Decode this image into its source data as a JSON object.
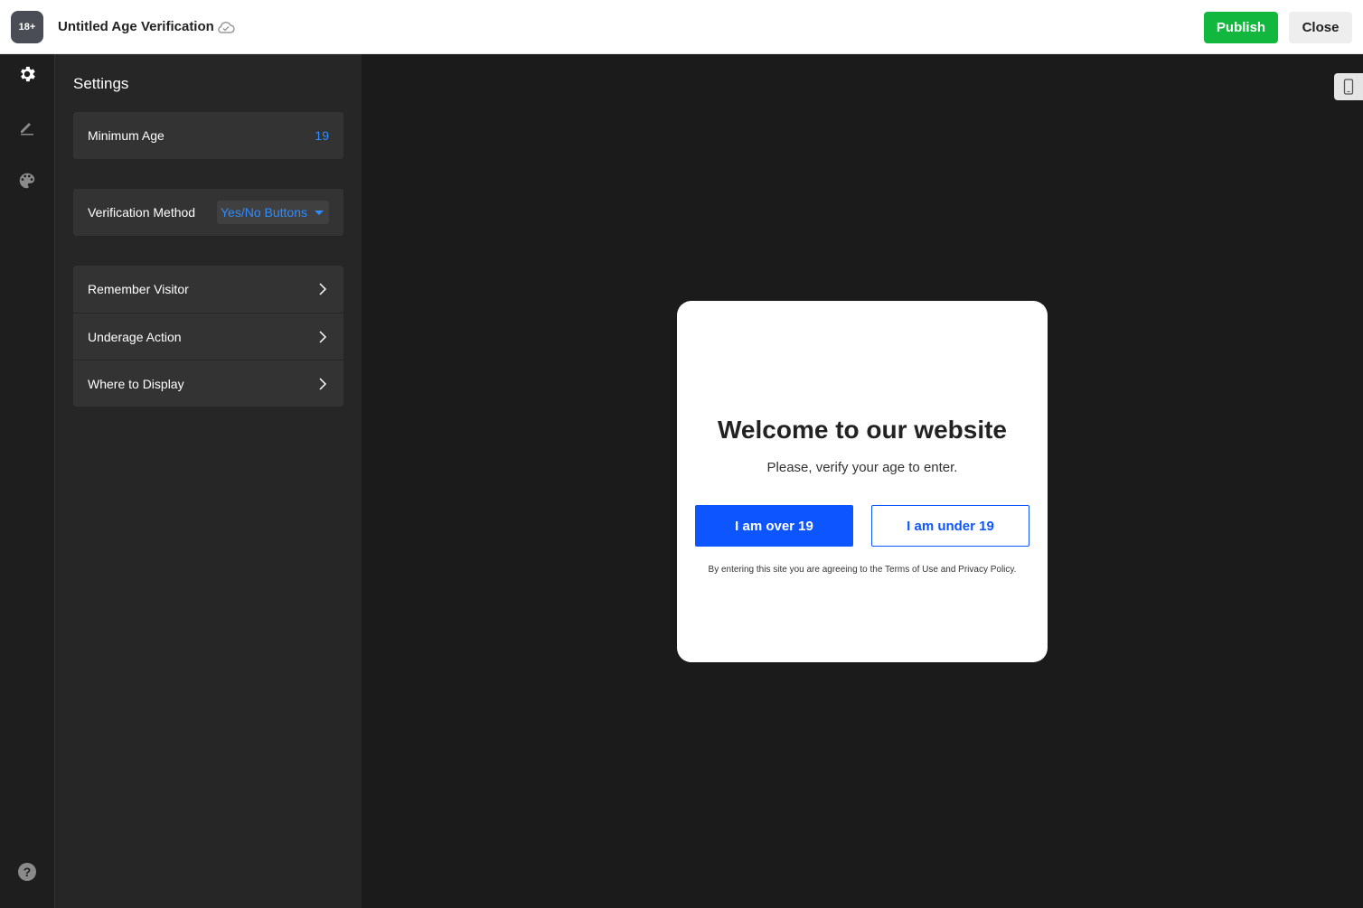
{
  "app": {
    "badge": "18+",
    "title": "Untitled Age Verification",
    "cloud_icon": "cloud-check-icon"
  },
  "toolbar": {
    "publish_label": "Publish",
    "close_label": "Close"
  },
  "rail": {
    "items": [
      {
        "icon": "gear-icon",
        "active": true
      },
      {
        "icon": "pencil-icon",
        "active": false
      },
      {
        "icon": "palette-icon",
        "active": false
      }
    ],
    "help_icon": "help-icon",
    "help_glyph": "?"
  },
  "settings": {
    "title": "Settings",
    "minimum_age": {
      "label": "Minimum Age",
      "value": "19"
    },
    "verification_method": {
      "label": "Verification Method",
      "value": "Yes/No Buttons"
    },
    "nav_items": [
      {
        "label": "Remember Visitor"
      },
      {
        "label": "Underage Action"
      },
      {
        "label": "Where to Display"
      }
    ]
  },
  "preview": {
    "device_icon": "mobile-device-icon",
    "heading": "Welcome to our website",
    "subheading": "Please, verify your age to enter.",
    "yes_label": "I am over 19",
    "no_label": "I am under 19",
    "terms": "By entering this site you are agreeing to the Terms of Use and Privacy Policy."
  },
  "colors": {
    "publish": "#12b83e",
    "accent_blue": "#0d55ff",
    "value_blue": "#2f8cff",
    "panel_bg": "#262626",
    "canvas_bg": "#1b1b1b"
  }
}
